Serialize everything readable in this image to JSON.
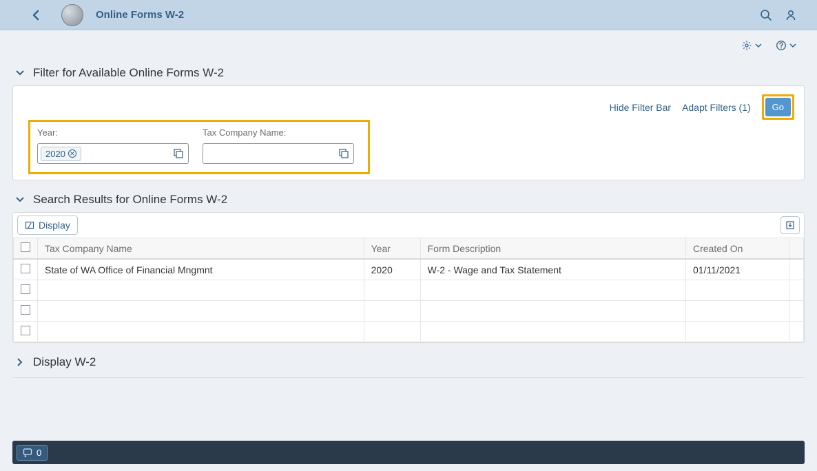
{
  "header": {
    "title": "Online Forms W-2"
  },
  "filter_panel": {
    "title": "Filter for Available Online Forms W-2",
    "hide_label": "Hide Filter Bar",
    "adapt_label": "Adapt Filters (1)",
    "go_label": "Go",
    "fields": {
      "year": {
        "label": "Year:",
        "token": "2020"
      },
      "company": {
        "label": "Tax Company Name:"
      }
    }
  },
  "results_panel": {
    "title": "Search Results for Online Forms W-2",
    "display_label": "Display",
    "columns": {
      "company": "Tax Company Name",
      "year": "Year",
      "desc": "Form Description",
      "created": "Created On"
    },
    "rows": [
      {
        "company": "State of WA Office of Financial Mngmnt",
        "year": "2020",
        "desc": "W-2 - Wage and Tax Statement",
        "created": "01/11/2021"
      }
    ]
  },
  "display_panel": {
    "title": "Display W-2"
  },
  "msg_bar": {
    "count": "0"
  }
}
